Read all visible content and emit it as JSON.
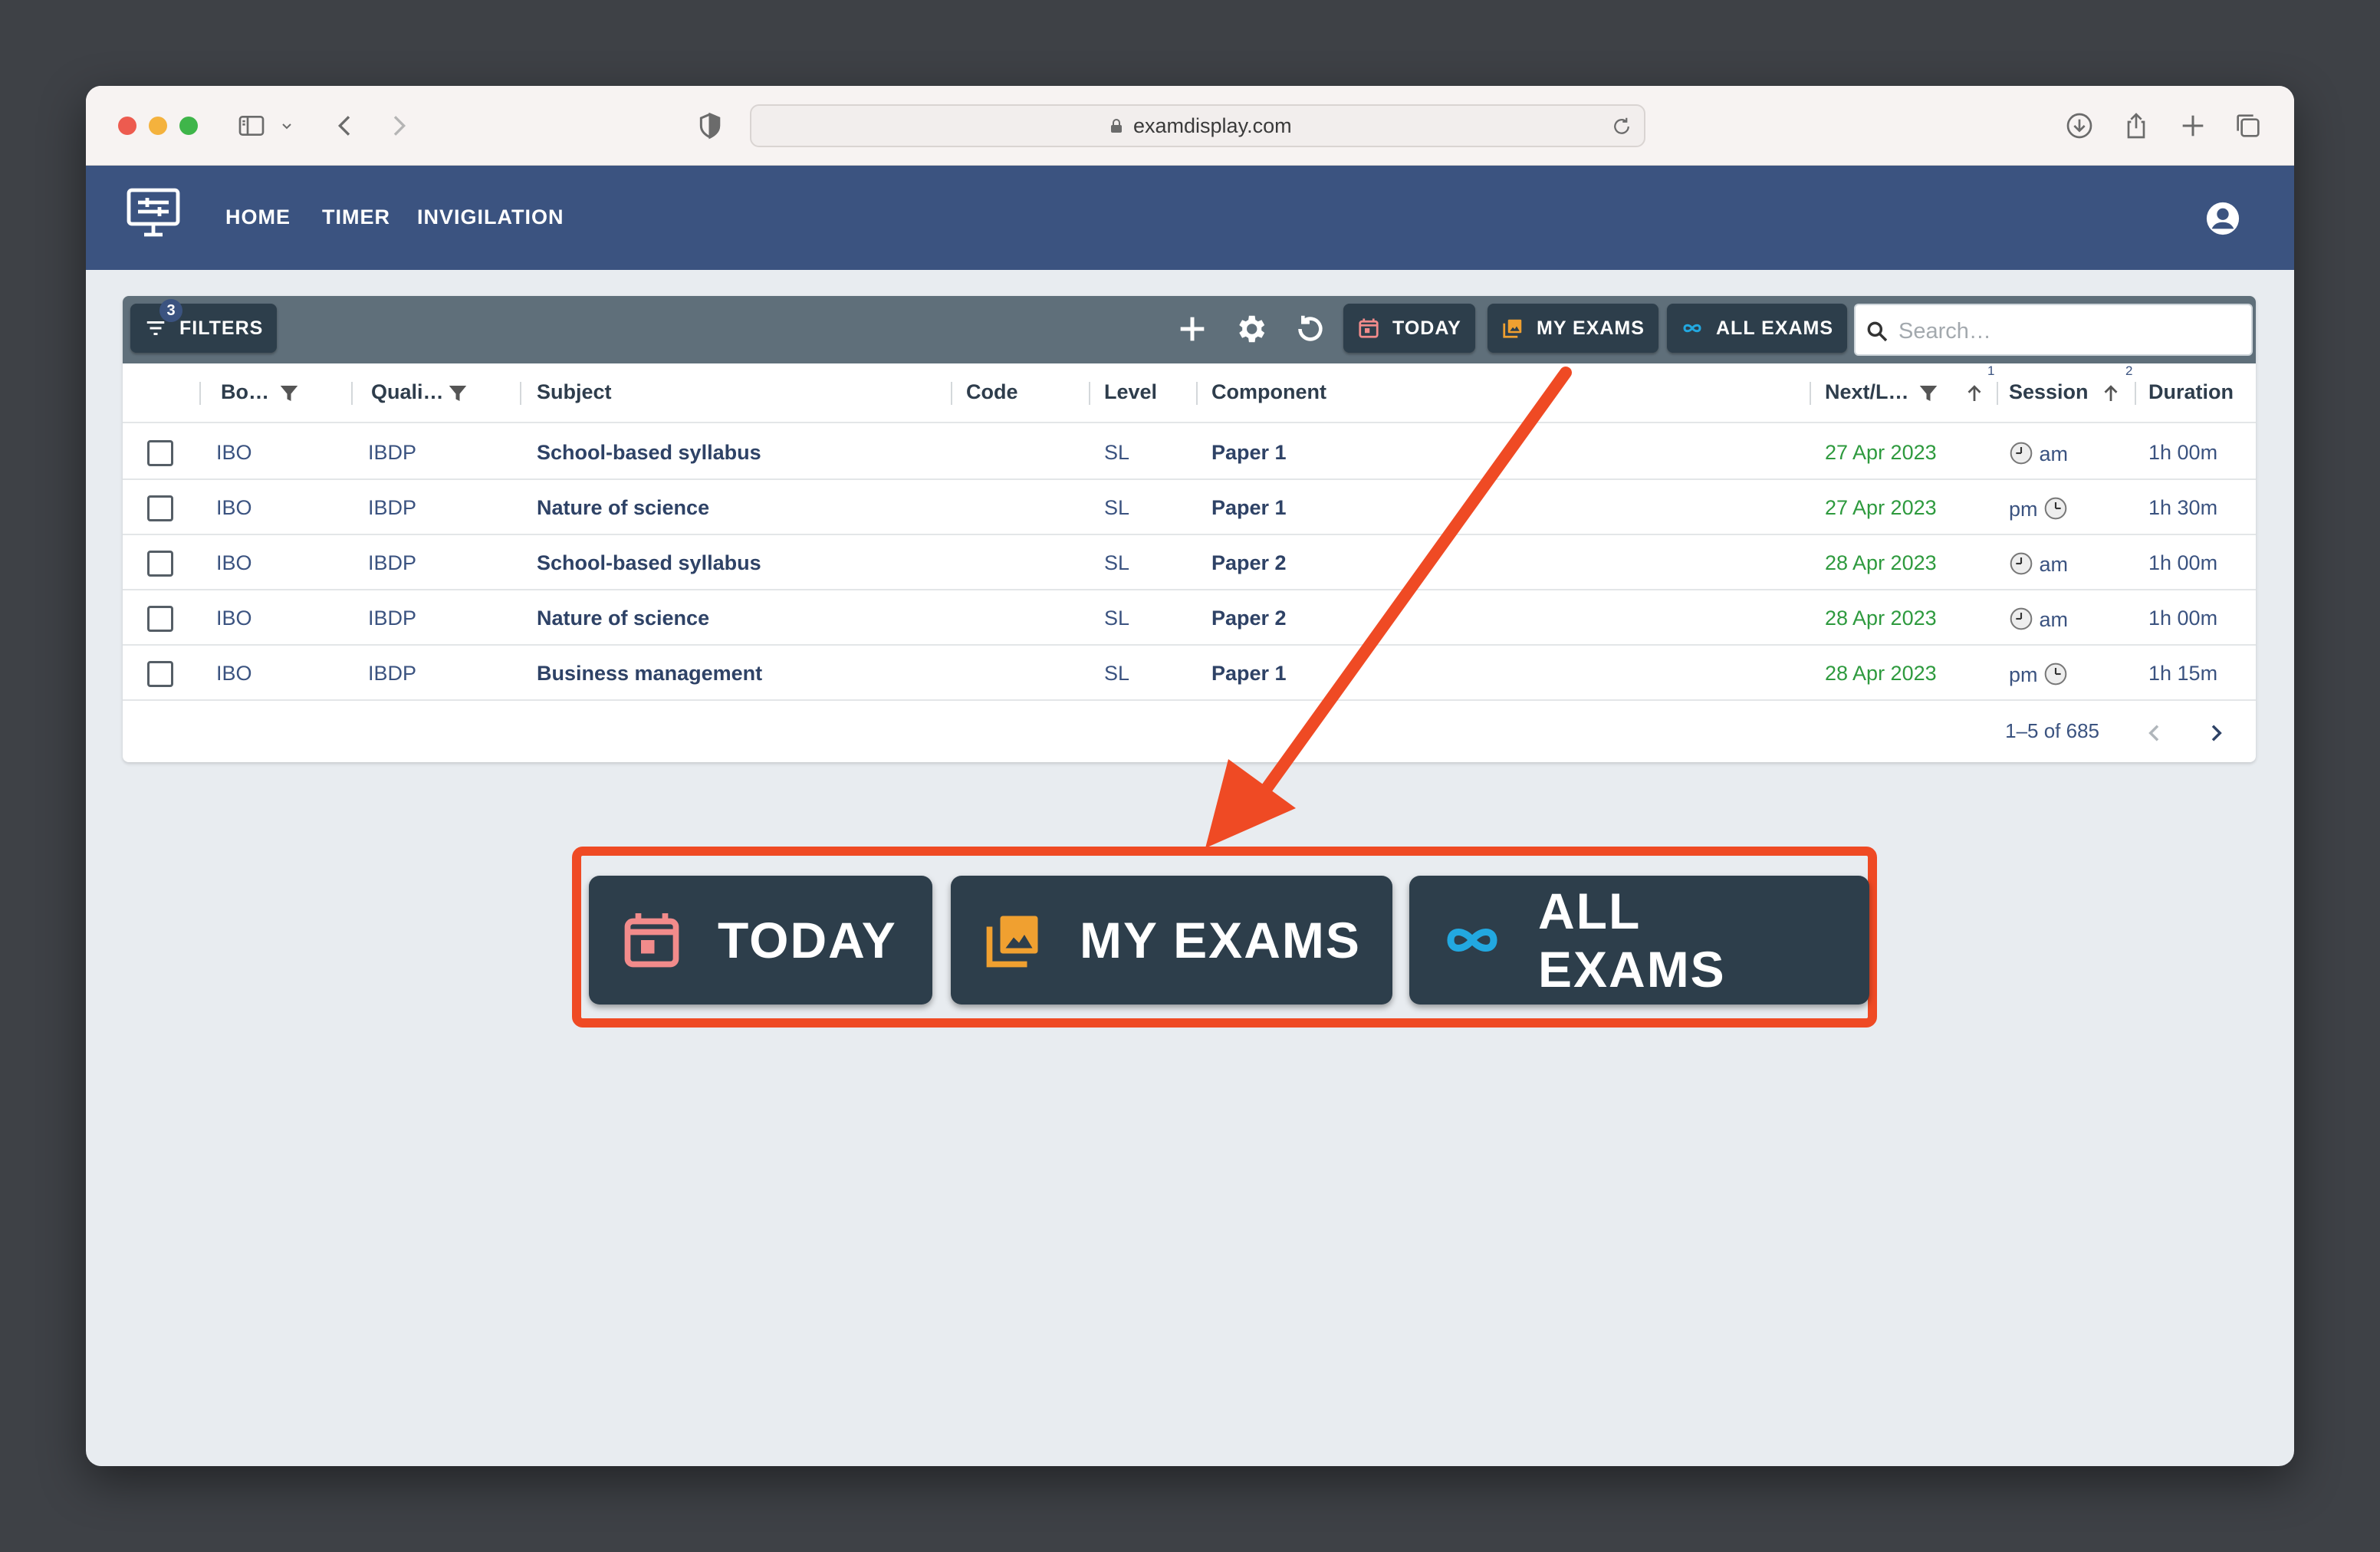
{
  "browser": {
    "url": "examdisplay.com"
  },
  "nav": {
    "items": [
      {
        "label": "HOME"
      },
      {
        "label": "TIMER"
      },
      {
        "label": "INVIGILATION"
      }
    ]
  },
  "toolbar": {
    "filters_label": "FILTERS",
    "filters_count": "3",
    "today_label": "TODAY",
    "my_exams_label": "MY EXAMS",
    "all_exams_label": "ALL EXAMS",
    "search_placeholder": "Search…"
  },
  "table": {
    "columns": [
      "Bo…",
      "Quali…",
      "Subject",
      "Code",
      "Level",
      "Component",
      "Next/L…",
      "Session",
      "Duration"
    ],
    "sort_indices": {
      "next": "1",
      "session": "2"
    },
    "rows": [
      {
        "board": "IBO",
        "qualification": "IBDP",
        "subject": "School-based syllabus",
        "code": "",
        "level": "SL",
        "component": "Paper 1",
        "date": "27 Apr 2023",
        "session": "am",
        "duration": "1h 00m"
      },
      {
        "board": "IBO",
        "qualification": "IBDP",
        "subject": "Nature of science",
        "code": "",
        "level": "SL",
        "component": "Paper 1",
        "date": "27 Apr 2023",
        "session": "pm",
        "duration": "1h 30m"
      },
      {
        "board": "IBO",
        "qualification": "IBDP",
        "subject": "School-based syllabus",
        "code": "",
        "level": "SL",
        "component": "Paper 2",
        "date": "28 Apr 2023",
        "session": "am",
        "duration": "1h 00m"
      },
      {
        "board": "IBO",
        "qualification": "IBDP",
        "subject": "Nature of science",
        "code": "",
        "level": "SL",
        "component": "Paper 2",
        "date": "28 Apr 2023",
        "session": "am",
        "duration": "1h 00m"
      },
      {
        "board": "IBO",
        "qualification": "IBDP",
        "subject": "Business management",
        "code": "",
        "level": "SL",
        "component": "Paper 1",
        "date": "28 Apr 2023",
        "session": "pm",
        "duration": "1h 15m"
      }
    ],
    "pagination": "1–5 of 685"
  },
  "callout": {
    "today_label": "TODAY",
    "my_exams_label": "MY EXAMS",
    "all_exams_label": "ALL EXAMS"
  },
  "colors": {
    "appbar": "#3b5380",
    "button_bg": "#2d3e4b",
    "date_green": "#2e9a3e",
    "highlight": "#ef4a24",
    "today_icon": "#f28b8b",
    "my_exams_icon": "#f0a030",
    "all_exams_icon": "#22a8e0"
  }
}
